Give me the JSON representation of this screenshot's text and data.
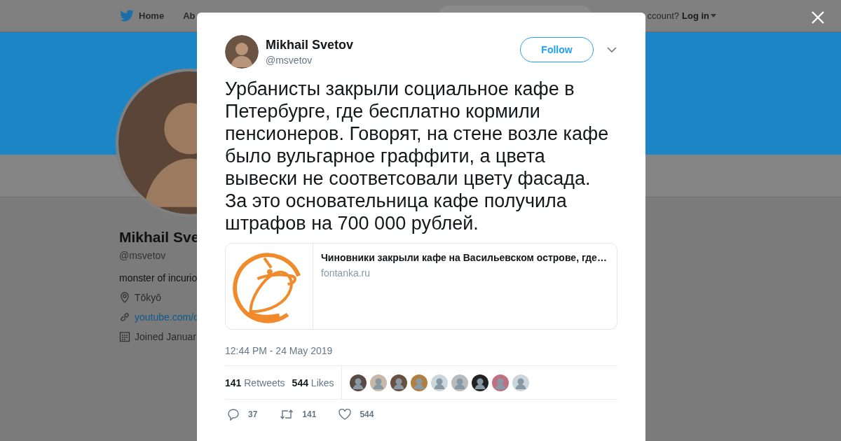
{
  "nav": {
    "items": [
      {
        "label": "Home"
      },
      {
        "label": "Ab"
      }
    ],
    "account_prompt": "ccount?",
    "login": "Log in"
  },
  "profile": {
    "name": "Mikhail Sve",
    "handle": "@msvetov",
    "bio": "monster of incurio",
    "location": "Tōkyō",
    "link": "youtube.com/c",
    "joined": "Joined Januar"
  },
  "tweet": {
    "author": "Mikhail Svetov",
    "handle": "@msvetov",
    "follow": "Follow",
    "text": "Урбанисты закрыли социальное кафе в Петербурге, где бесплатно кормили пенсионеров. Говорят, на стене возле кафе было вульгарное граффити, а цвета вывески не соответсовали цвету фасада. За это основательница кафе получила штрафов на 700 000 рублей.",
    "card": {
      "title": "Чиновники закрыли кафе на Васильевском острове, где…",
      "domain": "fontanka.ru"
    },
    "time": "12:44 PM - 24 May 2019",
    "stats": [
      {
        "count": "141",
        "label": "Retweets"
      },
      {
        "count": "544",
        "label": "Likes"
      }
    ],
    "actions": [
      {
        "kind": "reply",
        "count": "37"
      },
      {
        "kind": "retweet",
        "count": "141"
      },
      {
        "kind": "like",
        "count": "544"
      }
    ]
  }
}
